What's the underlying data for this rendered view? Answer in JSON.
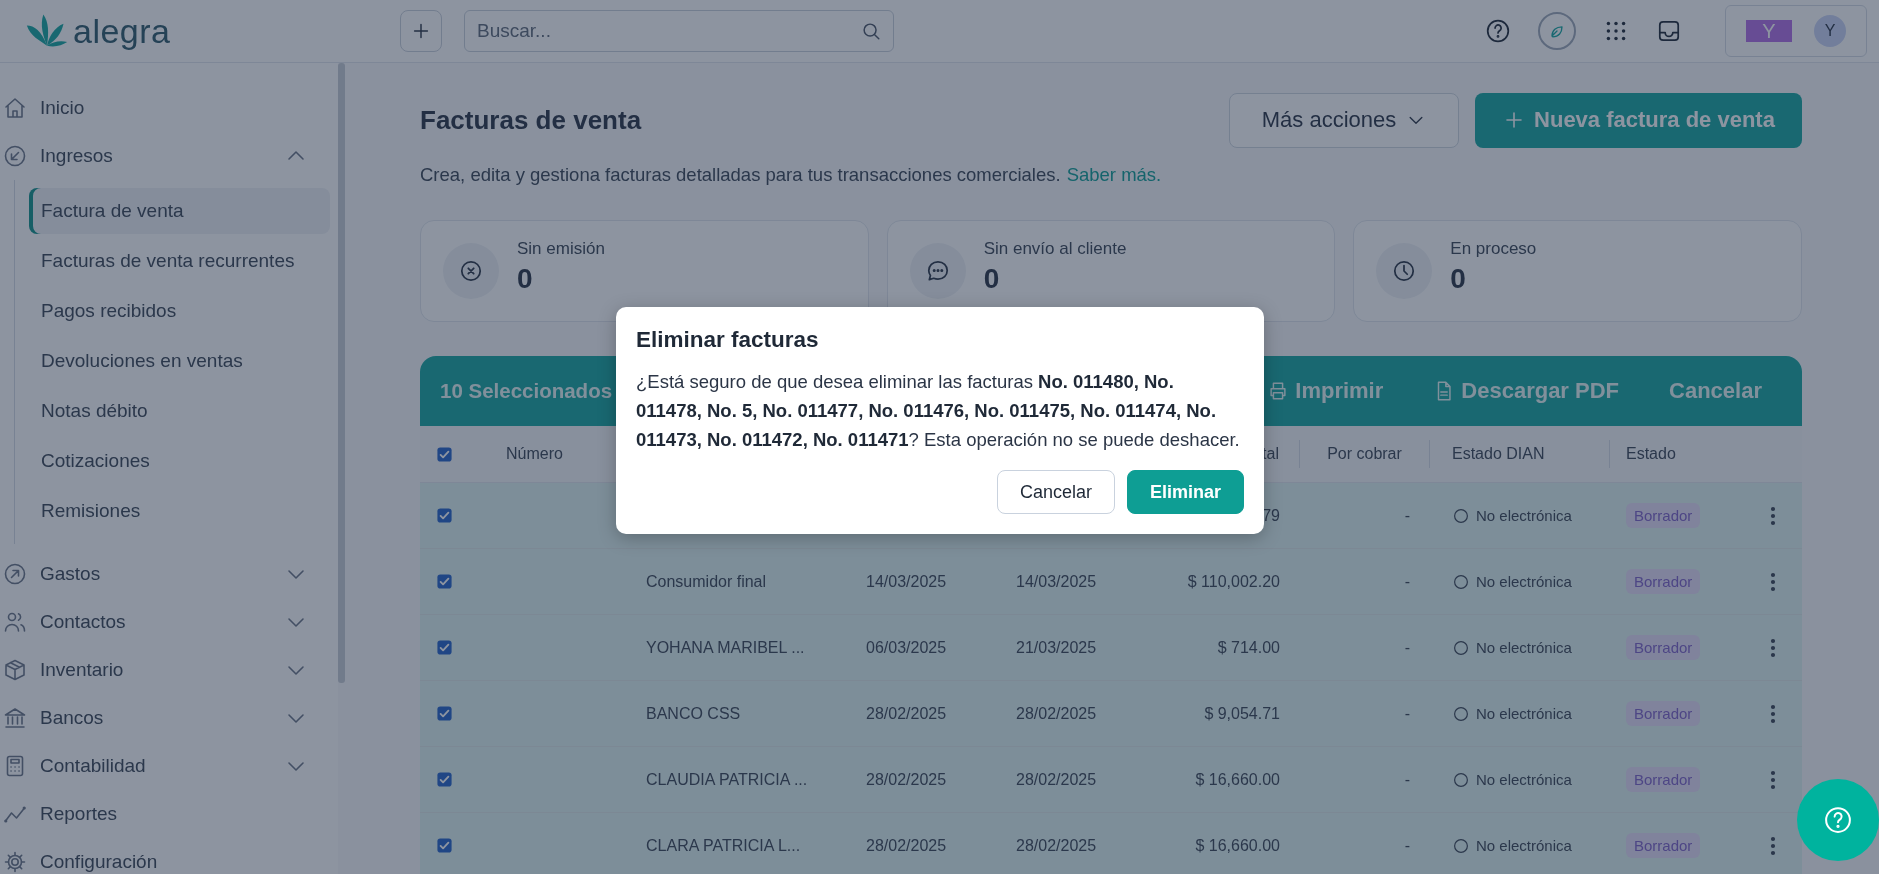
{
  "topbar": {
    "logo": "alegra",
    "search": {
      "placeholder": "Buscar..."
    },
    "company_badge": "Y",
    "avatar": "Y"
  },
  "sidebar": {
    "items": [
      {
        "label": "Inicio"
      },
      {
        "label": "Ingresos",
        "expanded": true,
        "children": [
          {
            "label": "Factura de venta",
            "selected": true
          },
          {
            "label": "Facturas de venta recurrentes",
            "selected": false
          },
          {
            "label": "Pagos recibidos",
            "selected": false
          },
          {
            "label": "Devoluciones en ventas",
            "selected": false
          },
          {
            "label": "Notas débito",
            "selected": false
          },
          {
            "label": "Cotizaciones",
            "selected": false
          },
          {
            "label": "Remisiones",
            "selected": false
          }
        ]
      },
      {
        "label": "Gastos",
        "expanded": false
      },
      {
        "label": "Contactos",
        "expanded": false
      },
      {
        "label": "Inventario",
        "expanded": false
      },
      {
        "label": "Bancos",
        "expanded": false
      },
      {
        "label": "Contabilidad",
        "expanded": false
      },
      {
        "label": "Reportes"
      },
      {
        "label": "Configuración"
      }
    ]
  },
  "page": {
    "title": "Facturas de venta",
    "description": "Crea, edita y gestiona facturas detalladas para tus transacciones comerciales.",
    "link": "Saber más.",
    "more_actions": "Más acciones",
    "new_button": "Nueva factura de venta"
  },
  "cards": [
    {
      "label": "Sin emisión",
      "value": "0"
    },
    {
      "label": "Sin envío al cliente",
      "value": "0"
    },
    {
      "label": "En proceso",
      "value": "0"
    }
  ],
  "table": {
    "selection_bar": {
      "count": "10 Seleccionados",
      "actions": [
        "Imprimir",
        "Descargar PDF",
        "Cancelar"
      ]
    },
    "all_checked": true,
    "columns": {
      "number": "Número",
      "total": "tal",
      "balance": "Por cobrar",
      "dian": "Estado DIAN",
      "status": "Estado"
    },
    "rows": [
      {
        "checked": true,
        "total": "79",
        "balance": "-",
        "dian": "No electrónica",
        "status": "Borrador"
      },
      {
        "checked": true,
        "client": "Consumidor final",
        "created": "14/03/2025",
        "due": "14/03/2025",
        "total": "$ 110,002.20",
        "balance": "-",
        "dian": "No electrónica",
        "status": "Borrador"
      },
      {
        "checked": true,
        "client": "YOHANA MARIBEL ...",
        "created": "06/03/2025",
        "due": "21/03/2025",
        "total": "$ 714.00",
        "balance": "-",
        "dian": "No electrónica",
        "status": "Borrador"
      },
      {
        "checked": true,
        "client": "BANCO CSS",
        "created": "28/02/2025",
        "due": "28/02/2025",
        "total": "$ 9,054.71",
        "balance": "-",
        "dian": "No electrónica",
        "status": "Borrador"
      },
      {
        "checked": true,
        "client": "CLAUDIA PATRICIA ...",
        "created": "28/02/2025",
        "due": "28/02/2025",
        "total": "$ 16,660.00",
        "balance": "-",
        "dian": "No electrónica",
        "status": "Borrador"
      },
      {
        "checked": true,
        "client": "CLARA PATRICIA L...",
        "created": "28/02/2025",
        "due": "28/02/2025",
        "total": "$ 16,660.00",
        "balance": "-",
        "dian": "No electrónica",
        "status": "Borrador"
      }
    ]
  },
  "dialog": {
    "title": "Eliminar facturas",
    "message": "¿Está seguro de que desea eliminar las facturas **No. 011480, No. 011478, No. 5, No. 011477, No. 011476, No. 011475, No. 011474, No. 011473, No. 011472, No. 011471**? Esta operación no se puede deshacer.",
    "buttons": [
      "Cancelar",
      "Eliminar"
    ]
  }
}
